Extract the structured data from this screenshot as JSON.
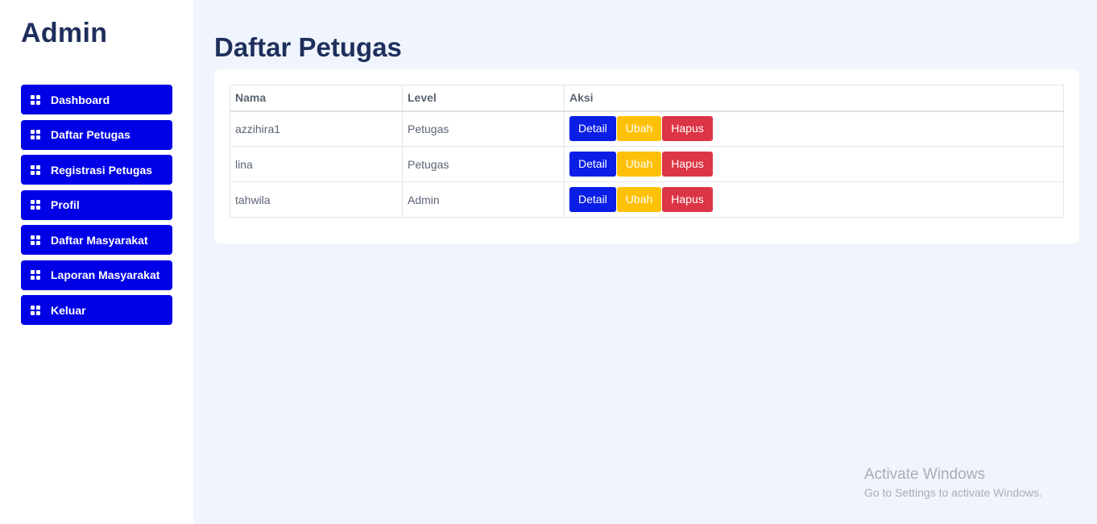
{
  "sidebar": {
    "brand": "Admin",
    "items": [
      {
        "label": "Dashboard",
        "icon": "grid-icon"
      },
      {
        "label": "Daftar Petugas",
        "icon": "grid-icon"
      },
      {
        "label": "Registrasi Petugas",
        "icon": "grid-icon"
      },
      {
        "label": "Profil",
        "icon": "grid-icon"
      },
      {
        "label": "Daftar Masyarakat",
        "icon": "grid-icon"
      },
      {
        "label": "Laporan Masyarakat",
        "icon": "grid-icon"
      },
      {
        "label": "Keluar",
        "icon": "grid-icon"
      }
    ]
  },
  "main": {
    "title": "Daftar Petugas",
    "table": {
      "headers": [
        "Nama",
        "Level",
        "Aksi"
      ],
      "rows": [
        {
          "nama": "azzihira1",
          "level": "Petugas"
        },
        {
          "nama": "lina",
          "level": "Petugas"
        },
        {
          "nama": "tahwila",
          "level": "Admin"
        }
      ],
      "actions": {
        "detail": "Detail",
        "ubah": "Ubah",
        "hapus": "Hapus"
      }
    }
  },
  "watermark": {
    "line1": "Activate Windows",
    "line2": "Go to Settings to activate Windows."
  },
  "colors": {
    "nav_button": "#0000e6",
    "detail": "#0a1ee6",
    "ubah": "#ffc107",
    "hapus": "#dc3545",
    "title": "#1e2f5c",
    "background": "#f0f5fd"
  }
}
